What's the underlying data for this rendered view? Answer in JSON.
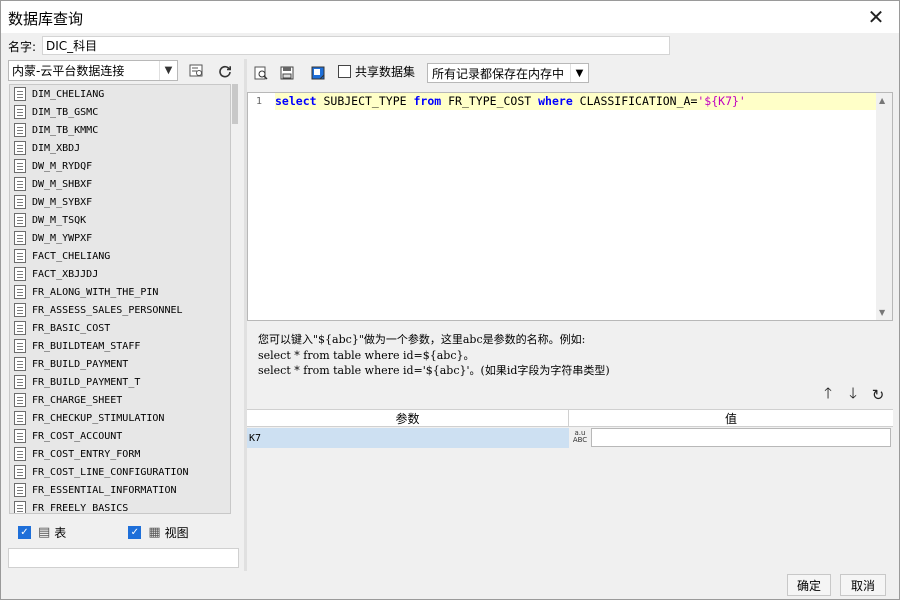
{
  "window": {
    "title": "数据库查询"
  },
  "name_row": {
    "label": "名字:",
    "value": "DIC_科目"
  },
  "left": {
    "connection": "内蒙-云平台数据连接",
    "tables": [
      "DIM_CHELIANG",
      "DIM_TB_GSMC",
      "DIM_TB_KMMC",
      "DIM_XBDJ",
      "DW_M_RYDQF",
      "DW_M_SHBXF",
      "DW_M_SYBXF",
      "DW_M_TSQK",
      "DW_M_YWPXF",
      "FACT_CHELIANG",
      "FACT_XBJJDJ",
      "FR_ALONG_WITH_THE_PIN",
      "FR_ASSESS_SALES_PERSONNEL",
      "FR_BASIC_COST",
      "FR_BUILDTEAM_STAFF",
      "FR_BUILD_PAYMENT",
      "FR_BUILD_PAYMENT_T",
      "FR_CHARGE_SHEET",
      "FR_CHECKUP_STIMULATION",
      "FR_COST_ACCOUNT",
      "FR_COST_ENTRY_FORM",
      "FR_COST_LINE_CONFIGURATION",
      "FR_ESSENTIAL_INFORMATION",
      "FR_FREELY_BASICS"
    ],
    "filter_table_label": "表",
    "filter_view_label": "视图"
  },
  "right": {
    "share_label": "共享数据集",
    "memory_option": "所有记录都保存在内存中",
    "sql": {
      "line_no": "1",
      "kw_select": "select",
      "field": " SUBJECT_TYPE ",
      "kw_from": "from",
      "table": " FR_TYPE_COST ",
      "kw_where": "where",
      "cond": " CLASSIFICATION_A=",
      "param": "'${K7}'"
    },
    "hint": [
      "您可以键入\"${abc}\"做为一个参数，这里abc是参数的名称。例如:",
      "select * from table where id=${abc}。",
      "select * from table where id='${abc}'。(如果id字段为字符串类型)"
    ],
    "param_table": {
      "col_param": "参数",
      "col_value": "值",
      "rows": [
        {
          "name": "K7",
          "type_icon": "ABC",
          "value": ""
        }
      ]
    }
  },
  "footer": {
    "ok": "确定",
    "cancel": "取消"
  }
}
